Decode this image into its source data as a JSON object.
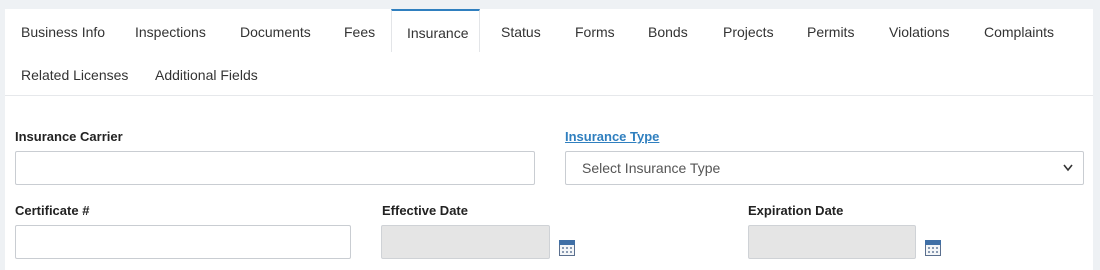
{
  "tabs": [
    {
      "label": "Business Info",
      "active": false
    },
    {
      "label": "Inspections",
      "active": false
    },
    {
      "label": "Documents",
      "active": false
    },
    {
      "label": "Fees",
      "active": false
    },
    {
      "label": "Insurance",
      "active": true
    },
    {
      "label": "Status",
      "active": false
    },
    {
      "label": "Forms",
      "active": false
    },
    {
      "label": "Bonds",
      "active": false
    },
    {
      "label": "Projects",
      "active": false
    },
    {
      "label": "Permits",
      "active": false
    },
    {
      "label": "Violations",
      "active": false
    },
    {
      "label": "Complaints",
      "active": false
    },
    {
      "label": "Related Licenses",
      "active": false
    },
    {
      "label": "Additional Fields",
      "active": false
    }
  ],
  "form": {
    "insurance_carrier": {
      "label": "Insurance Carrier",
      "value": ""
    },
    "insurance_type": {
      "label": "Insurance Type",
      "selected": "Select Insurance Type"
    },
    "certificate": {
      "label": "Certificate #",
      "value": ""
    },
    "effective_date": {
      "label": "Effective Date",
      "value": ""
    },
    "expiration_date": {
      "label": "Expiration Date",
      "value": ""
    }
  },
  "icons": {
    "calendar": "calendar-icon",
    "select_arrow": "chevron-down-icon"
  },
  "colors": {
    "accent": "#2f7fbf",
    "disabled_field": "#e5e5e5"
  }
}
